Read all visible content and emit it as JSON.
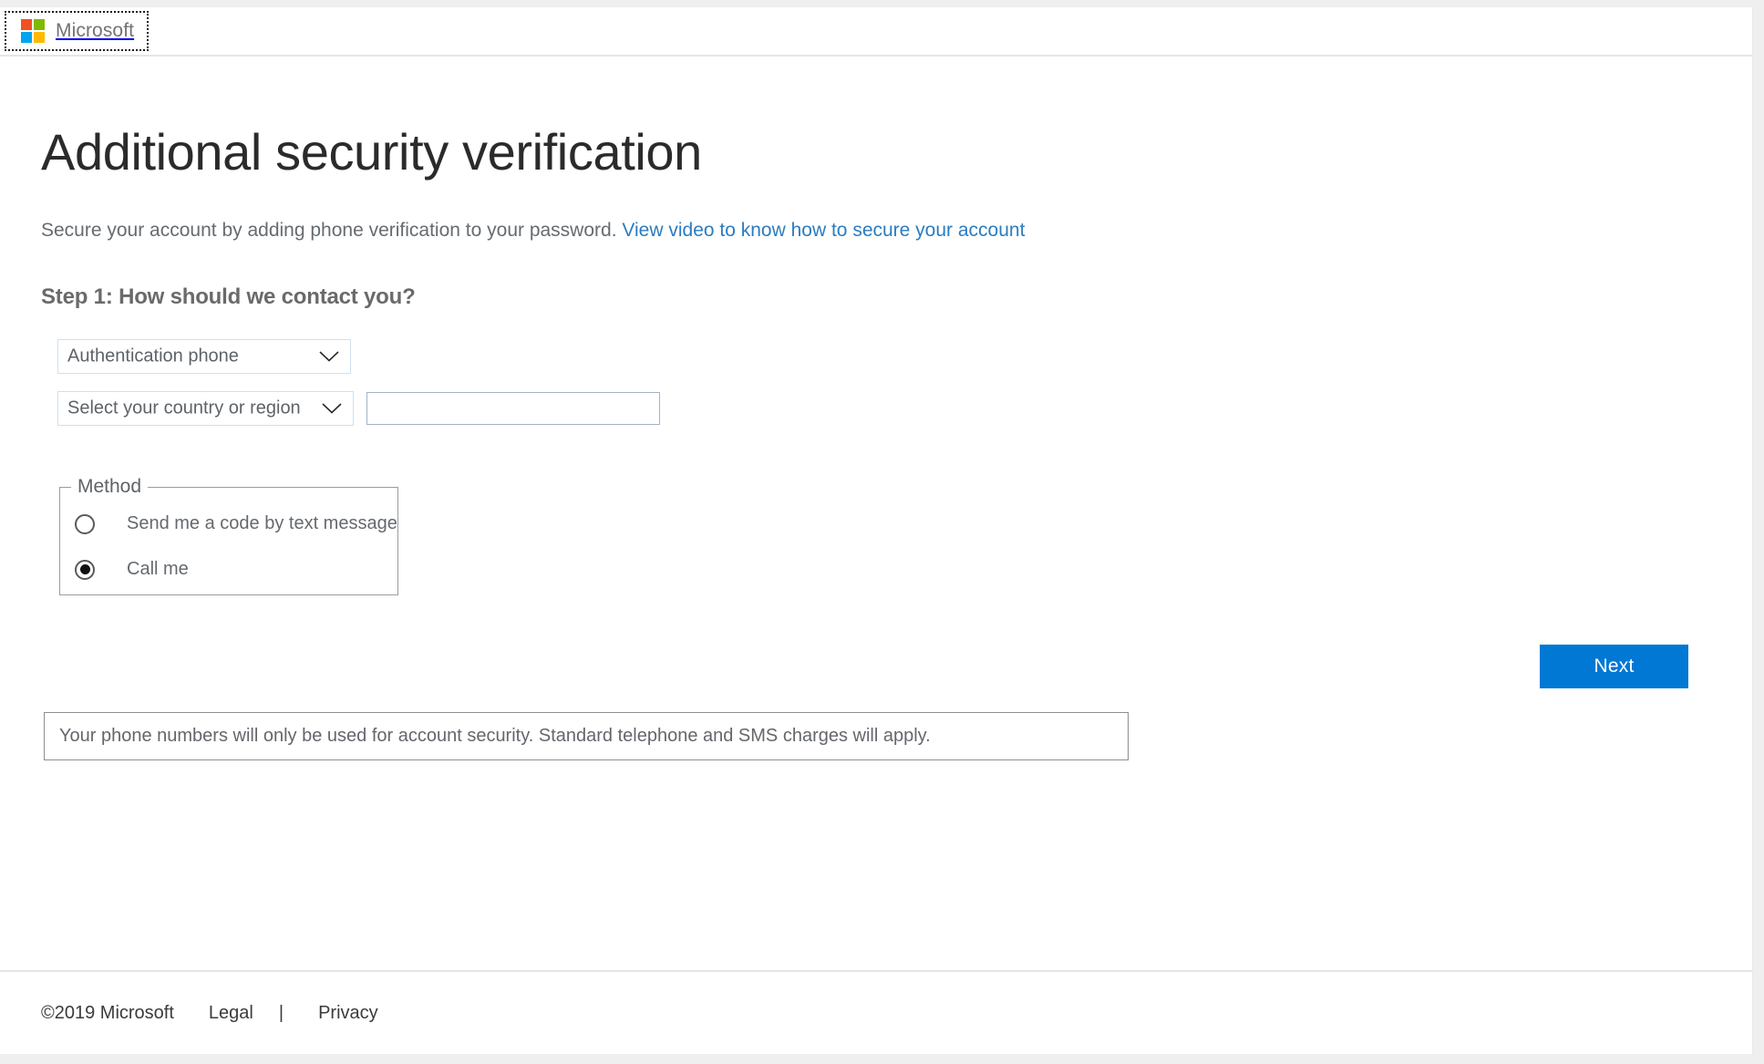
{
  "header": {
    "logo_icon": "microsoft-logo-icon",
    "brand_name": "Microsoft"
  },
  "main": {
    "page_title": "Additional security verification",
    "intro_text": "Secure your account by adding phone verification to your password.",
    "intro_link": "View video to know how to secure your account",
    "step_title": "Step 1: How should we contact you?",
    "contact_method_select": {
      "value": "Authentication phone",
      "chevron_icon": "chevron-down-icon"
    },
    "country_select": {
      "value": "Select your country or region",
      "chevron_icon": "chevron-down-icon"
    },
    "phone_input": {
      "value": "",
      "placeholder": ""
    },
    "method_fieldset": {
      "legend": "Method",
      "options": [
        {
          "label": "Send me a code by text message",
          "checked": false
        },
        {
          "label": "Call me",
          "checked": true
        }
      ]
    },
    "next_label": "Next",
    "disclaimer": "Your phone numbers will only be used for account security. Standard telephone and SMS charges will apply."
  },
  "footer": {
    "copyright": "©2019 Microsoft",
    "legal": "Legal",
    "separator": "|",
    "privacy": "Privacy"
  },
  "colors": {
    "accent_blue": "#0078d4",
    "link_blue": "#2b7cc0",
    "logo_red": "#f25022",
    "logo_green": "#7fba00",
    "logo_blue": "#00a4ef",
    "logo_yellow": "#ffb900"
  }
}
